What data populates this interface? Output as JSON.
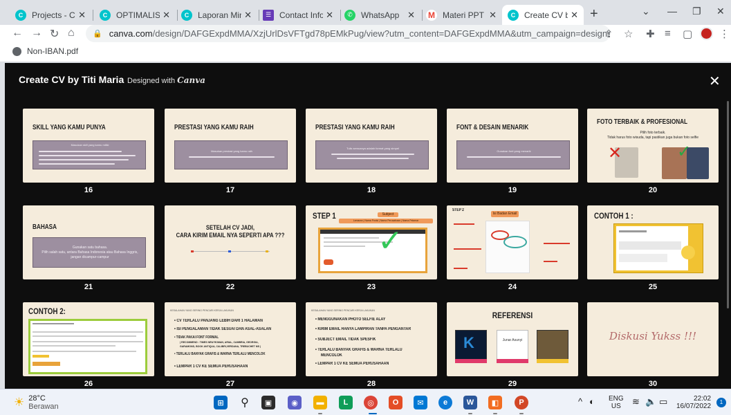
{
  "browser": {
    "tabs": [
      {
        "label": "Projects - Canva",
        "icon": "canva-icon",
        "color": "#00c4cc"
      },
      {
        "label": "OPTIMALISASI",
        "icon": "canva-icon",
        "color": "#00c4cc"
      },
      {
        "label": "Laporan Mingg",
        "icon": "canva-icon",
        "color": "#00c4cc"
      },
      {
        "label": "Contact Inform",
        "icon": "forms-icon",
        "color": "#673ab7"
      },
      {
        "label": "WhatsApp",
        "icon": "whatsapp-icon",
        "color": "#25d366"
      },
      {
        "label": "Materi PPT We",
        "icon": "gmail-icon",
        "color": "#ea4335"
      },
      {
        "label": "Create CV by T",
        "icon": "canva-icon",
        "color": "#00c4cc"
      }
    ],
    "url_host": "canva.com",
    "url_rest": "/design/DAFGExpdMMA/XzjUrlDsVFTgd78pEMkPug/view?utm_content=DAFGExpdMMA&utm_campaign=designshare&utm_m...",
    "bookmark": "Non-IBAN.pdf"
  },
  "viewer": {
    "title": "Create CV by Titi Maria",
    "designed_with": "Designed with",
    "brand": "Canva"
  },
  "slides": [
    {
      "num": "16",
      "title": "SKILL YANG KAMU PUNYA",
      "box_text": "Masukan skill yang kamu miliki"
    },
    {
      "num": "17",
      "title": "PRESTASI YANG KAMU RAIH",
      "box_text": "Masukan prestasi yang kamu raih"
    },
    {
      "num": "18",
      "title": "PRESTASI YANG KAMU RAIH",
      "box_text": "Tulis semuanya adalah format yang simpel"
    },
    {
      "num": "19",
      "title": "FONT & DESAIN MENARIK",
      "box_text": "Gunakan font yang menarik"
    },
    {
      "num": "20",
      "title": "FOTO TERBAIK & PROFESIONAL",
      "sub1": "Pilih foto terbaik.",
      "sub2": "Tidak harus foto wisuda, tapi pastikan juga bukan foto selfie"
    },
    {
      "num": "21",
      "title": "BAHASA",
      "box_text1": "Gunakan satu bahasa.",
      "box_text2": "Pilih salah satu, antara Bahasa Indonesia atau Bahasa Inggris,",
      "box_text3": "jangan dicampur-campur"
    },
    {
      "num": "22",
      "line1": "SETELAH CV JADI,",
      "line2": "CARA KIRIM EMAIL NYA SEPERTI APA ???"
    },
    {
      "num": "23",
      "title": "STEP 1",
      "pill": "Subject",
      "pill2": "Lamaran | Nama Posisi | Nama Perusahaan | Nama Pelamar"
    },
    {
      "num": "24",
      "title": "STEP 2",
      "pill": "Isi Badan Email"
    },
    {
      "num": "25",
      "title": "CONTOH 1 :"
    },
    {
      "num": "26",
      "title": "CONTOH 2:"
    },
    {
      "num": "27",
      "head": "KESALAHAN YANG SERING PENCARI KERJA LAKUKAN",
      "bullets": [
        "CV TERLALU PANJANG LEBIH DARI 1 HALAMAN",
        "ISI PENGALAMAN TIDAK SESUAI DAN ASAL-ASALAN",
        "TIDAK PAKAI FONT FORMAL",
        "( RECOMMEND : TIMES NEW ROMAN, ARIAL, CAMBRIA, GEORGIA,",
        "GARAMOND, BOOK ANTIQUA, CALIBRI,VERDANA, TREBUCHET MS )",
        "TERLALU BANYAK GRAFIS & WARNA TERLALU MENCOLOK",
        "LEMPAR 1 CV KE SEMUA PERUSAHAAN"
      ]
    },
    {
      "num": "28",
      "head": "KESALAHAN YANG SERING PENCARI KERJA LAKUKAN",
      "bullets": [
        "MENGGUNAKAN PHOTO SELFIE ALAY",
        "KIRIM EMAIL HANYA LAMPIRAN TANPA PENGANTAR",
        "SUBJECT EMAIL TIDAK SPESFIK",
        "TERLALU BANYAK GRAFIS & WARNA TERLALU",
        "MENCOLOK",
        "LEMPAR 1 CV KE SEMUA PERUSAHAAN"
      ]
    },
    {
      "num": "29",
      "title": "REFERENSI",
      "ref_name": "Junar Asunyi"
    },
    {
      "num": "30",
      "script": "Diskusi Yukss !!!"
    }
  ],
  "taskbar": {
    "temp": "28°C",
    "weather": "Berawan",
    "lang1": "ENG",
    "lang2": "US",
    "time": "22:02",
    "date": "16/07/2022",
    "notif": "1"
  }
}
